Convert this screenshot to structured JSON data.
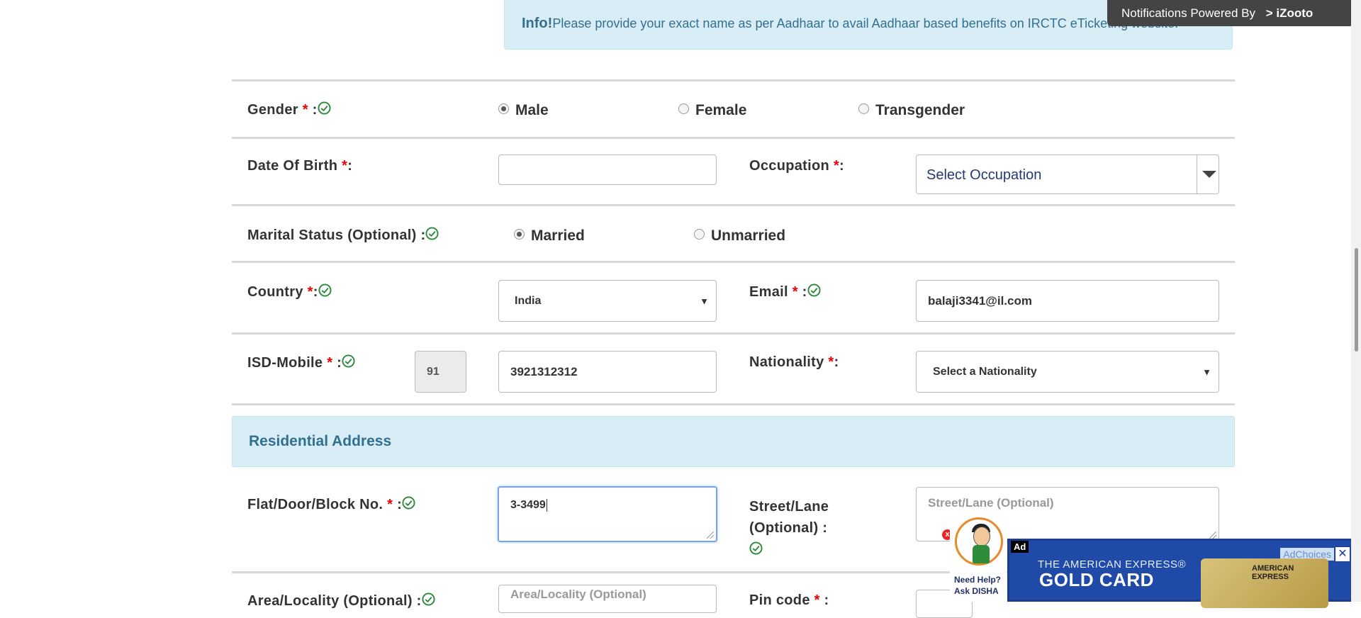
{
  "info": {
    "title": "Info!",
    "text": "Please provide your exact name as per Aadhaar to avail Aadhaar based benefits on IRCTC eTicketing website."
  },
  "notification": {
    "text": "Notifications Powered By",
    "brand": "iZooto"
  },
  "gender": {
    "label": "Gender",
    "req": "*",
    "suffix": " :",
    "options": [
      "Male",
      "Female",
      "Transgender"
    ],
    "selected": "Male"
  },
  "dob": {
    "label": "Date Of Birth",
    "req": "*",
    "suffix": ":",
    "value": ""
  },
  "occupation": {
    "label": "Occupation",
    "req": "*",
    "suffix": ":",
    "value": "Select Occupation"
  },
  "marital": {
    "label": "Marital Status (Optional) :",
    "options": [
      "Married",
      "Unmarried"
    ],
    "selected": "Married"
  },
  "country": {
    "label": "Country",
    "req": "*",
    "suffix": ":",
    "value": "India"
  },
  "email": {
    "label": "Email",
    "req": "*",
    "suffix": " :",
    "value": "balaji3341@il.com"
  },
  "isd_mobile": {
    "label": "ISD-Mobile",
    "req": "*",
    "suffix": " :",
    "isd": "91",
    "mobile": "3921312312"
  },
  "nationality": {
    "label": "Nationality",
    "req": "*",
    "suffix": ":",
    "value": "Select a Nationality"
  },
  "residential": {
    "title": "Residential Address"
  },
  "flat": {
    "label": "Flat/Door/Block No.",
    "req": "*",
    "suffix": " :",
    "value": "3-3499"
  },
  "street": {
    "label_line1": "Street/Lane",
    "label_line2": "(Optional) :",
    "placeholder": "Street/Lane (Optional)"
  },
  "area": {
    "label": "Area/Locality (Optional) :",
    "placeholder": "Area/Locality (Optional)"
  },
  "pincode": {
    "label": "Pin code",
    "req": "*",
    "suffix": " :"
  },
  "disha": {
    "line1": "Need Help?",
    "line2": "Ask DISHA",
    "close": "x"
  },
  "ad": {
    "tag": "Ad",
    "choices": "AdChoices",
    "close": "✕",
    "line1": "THE AMERICAN EXPRESS®",
    "line2": "GOLD CARD",
    "card_text": "AMERICAN EXPRESS"
  },
  "colors": {
    "check": "#2a8a3a",
    "required": "#ee0000",
    "info_bg": "#d9edf7",
    "info_text": "#31708f"
  }
}
